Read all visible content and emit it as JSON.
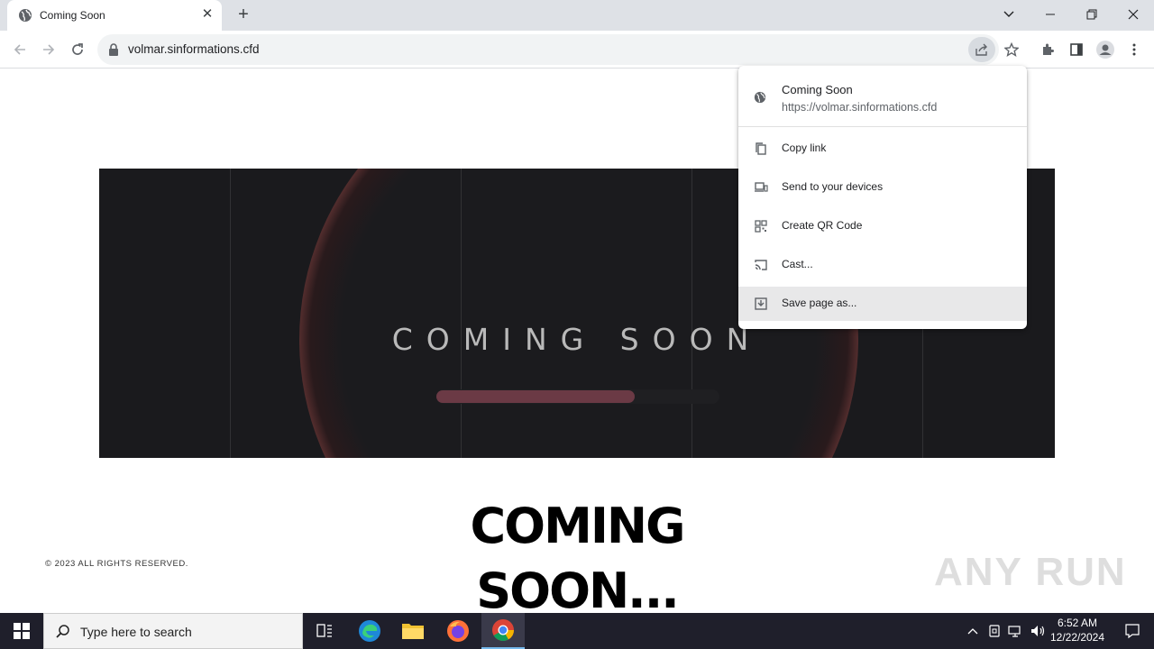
{
  "browser": {
    "tab": {
      "title": "Coming Soon",
      "close_glyph": "✕"
    },
    "new_tab_glyph": "+",
    "url": "volmar.sinformations.cfd"
  },
  "share_menu": {
    "page_title": "Coming Soon",
    "page_url": "https://volmar.sinformations.cfd",
    "items": [
      {
        "label": "Copy link",
        "icon": "copy-icon"
      },
      {
        "label": "Send to your devices",
        "icon": "devices-icon"
      },
      {
        "label": "Create QR Code",
        "icon": "qr-code-icon"
      },
      {
        "label": "Cast...",
        "icon": "cast-icon"
      },
      {
        "label": "Save page as...",
        "icon": "save-icon"
      }
    ]
  },
  "page": {
    "banner_headline": "COMING SOON",
    "progress_fraction": 0.7,
    "big_title_line1": "COMING",
    "big_title_line2": "SOON...",
    "copyright": "© 2023 ALL RIGHTS RESERVED.",
    "watermark": "ANY RUN"
  },
  "taskbar": {
    "search_placeholder": "Type here to search",
    "time": "6:52 AM",
    "date": "12/22/2024"
  },
  "colors": {
    "banner_bg": "#1a1a1d",
    "progress_fill": "#6b3a45",
    "taskbar_bg": "#1f1f2b"
  }
}
